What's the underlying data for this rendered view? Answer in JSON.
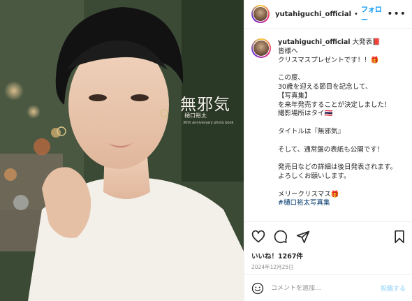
{
  "photo": {
    "cover_title": "無邪気",
    "cover_author": "樋口裕太",
    "cover_subtitle": "30th anniversary photo book"
  },
  "header": {
    "username": "yutahiguchi_official",
    "separator": "•",
    "follow_label": "フォロー",
    "more_icon": "ellipsis-icon"
  },
  "caption": {
    "username": "yutahiguchi_official",
    "body": " 大発表📕\n皆様へ\nクリスマスプレゼントです！！🎁\n\nこの度、\n30歳を迎える節目を記念して、\n【写真集】\nを来年発売することが決定しました！\n撮影場所はタイ🇹🇭\n\nタイトルは『無邪気』\n\nそして、通常盤の表紙も公開です！\n\n発売日などの詳細は後日発表されます。\nよろしくお願いします。\n\nメリークリスマス🎁\n",
    "hashtag": "#樋口裕太写真集"
  },
  "actions": {
    "icons": [
      "heart-icon",
      "comment-icon",
      "share-icon",
      "bookmark-icon"
    ]
  },
  "likes": "いいね！1267件",
  "date": "2024年12月25日",
  "comment": {
    "placeholder": "コメントを追加...",
    "post_label": "投稿する"
  },
  "colors": {
    "link": "#0095f6",
    "hashtag": "#00376b",
    "muted": "#8e8e8e",
    "post_disabled": "#b2dffc"
  }
}
